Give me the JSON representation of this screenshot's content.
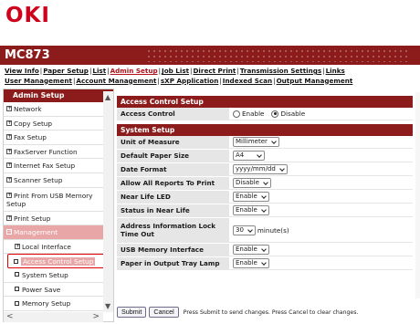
{
  "logo": "OKI",
  "model": "MC873",
  "nav": {
    "row1": [
      "View Info",
      "Paper Setup",
      "List",
      "Admin Setup",
      "Job List",
      "Direct Print",
      "Transmission Settings",
      "Links"
    ],
    "row2": [
      "User Management",
      "Account Management",
      "sXP Application",
      "Indexed Scan",
      "Output Management"
    ],
    "active": "Admin Setup"
  },
  "sidebar": {
    "title": "Admin Setup",
    "items": [
      {
        "label": "Network",
        "marker": "⊞"
      },
      {
        "label": "Copy Setup",
        "marker": "⊞"
      },
      {
        "label": "Fax Setup",
        "marker": "⊞"
      },
      {
        "label": "FaxServer Function",
        "marker": "⊞"
      },
      {
        "label": "Internet Fax Setup",
        "marker": "⊞"
      },
      {
        "label": "Scanner Setup",
        "marker": "⊞"
      },
      {
        "label": "Print From USB Memory Setup",
        "marker": "⊞"
      },
      {
        "label": "Print Setup",
        "marker": "⊞"
      },
      {
        "label": "Management",
        "marker": "⊟"
      },
      {
        "label": "Local Interface",
        "marker": "⊞"
      },
      {
        "label": "Access Control Setup"
      },
      {
        "label": "System Setup"
      },
      {
        "label": "Power Save"
      },
      {
        "label": "Memory Setup"
      }
    ]
  },
  "access_control": {
    "header": "Access Control Setup",
    "label": "Access Control",
    "enable_label": "Enable",
    "disable_label": "Disable",
    "selected": "Disable"
  },
  "system_setup": {
    "header": "System Setup",
    "rows": [
      {
        "label": "Unit of Measure",
        "value": "Millimeter"
      },
      {
        "label": "Default Paper Size",
        "value": "A4"
      },
      {
        "label": "Date Format",
        "value": "yyyy/mm/dd"
      },
      {
        "label": "Allow All Reports To Print",
        "value": "Disable"
      },
      {
        "label": "Near Life LED",
        "value": "Enable"
      },
      {
        "label": "Status in Near Life",
        "value": "Enable"
      },
      {
        "label": "Address Information Lock Time Out",
        "value": "30",
        "unit": "minute(s)"
      },
      {
        "label": "USB Memory Interface",
        "value": "Enable"
      },
      {
        "label": "Paper in Output Tray Lamp",
        "value": "Enable"
      }
    ]
  },
  "footer": {
    "submit_label": "Submit",
    "cancel_label": "Cancel",
    "message": "Press Submit to send changes. Press Cancel to clear changes."
  },
  "scrollbars": {
    "up_icon": "▲",
    "down_icon": "▼",
    "left_icon": "<",
    "right_icon": ">"
  },
  "colors": {
    "brand_red": "#d0021b",
    "header_bar": "#8c1c1c",
    "selected_highlight": "#e8a6a6",
    "selection_outline": "#e00000"
  }
}
